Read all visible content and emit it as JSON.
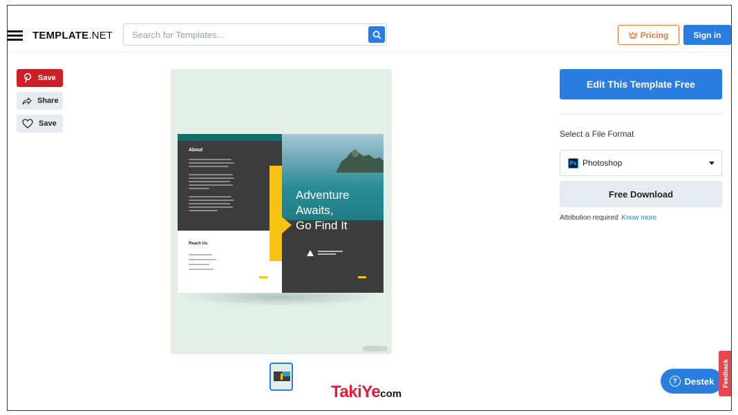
{
  "header": {
    "logo_bold": "TEMPLATE",
    "logo_light": ".NET",
    "search_placeholder": "Search for Templates...",
    "pricing_label": "Pricing",
    "signin_label": "Sign in"
  },
  "social": {
    "pinterest_save": "Save",
    "share": "Share",
    "save": "Save"
  },
  "preview": {
    "about_title": "About",
    "reach_title": "Reach Us",
    "headline_line1": "Adventure",
    "headline_line2": "Awaits,",
    "headline_line3": "Go Find It"
  },
  "watermark": {
    "brand": "Taki",
    "brand_accent": "Ye",
    "brand_suffix": "com"
  },
  "sidebar": {
    "edit_button": "Edit This Template Free",
    "format_label": "Select a File Format",
    "format_icon_text": "Ps",
    "format_value": "Photoshop",
    "download_button": "Free Download",
    "attribution_text": "Attribution required",
    "know_more": "Know more"
  },
  "support": {
    "destek_label": "Destek",
    "feedback_label": "Feedback"
  },
  "colors": {
    "primary": "#2a7de1",
    "pricing": "#f07a3c",
    "pinterest": "#cb2027",
    "feedback": "#e8464f"
  }
}
